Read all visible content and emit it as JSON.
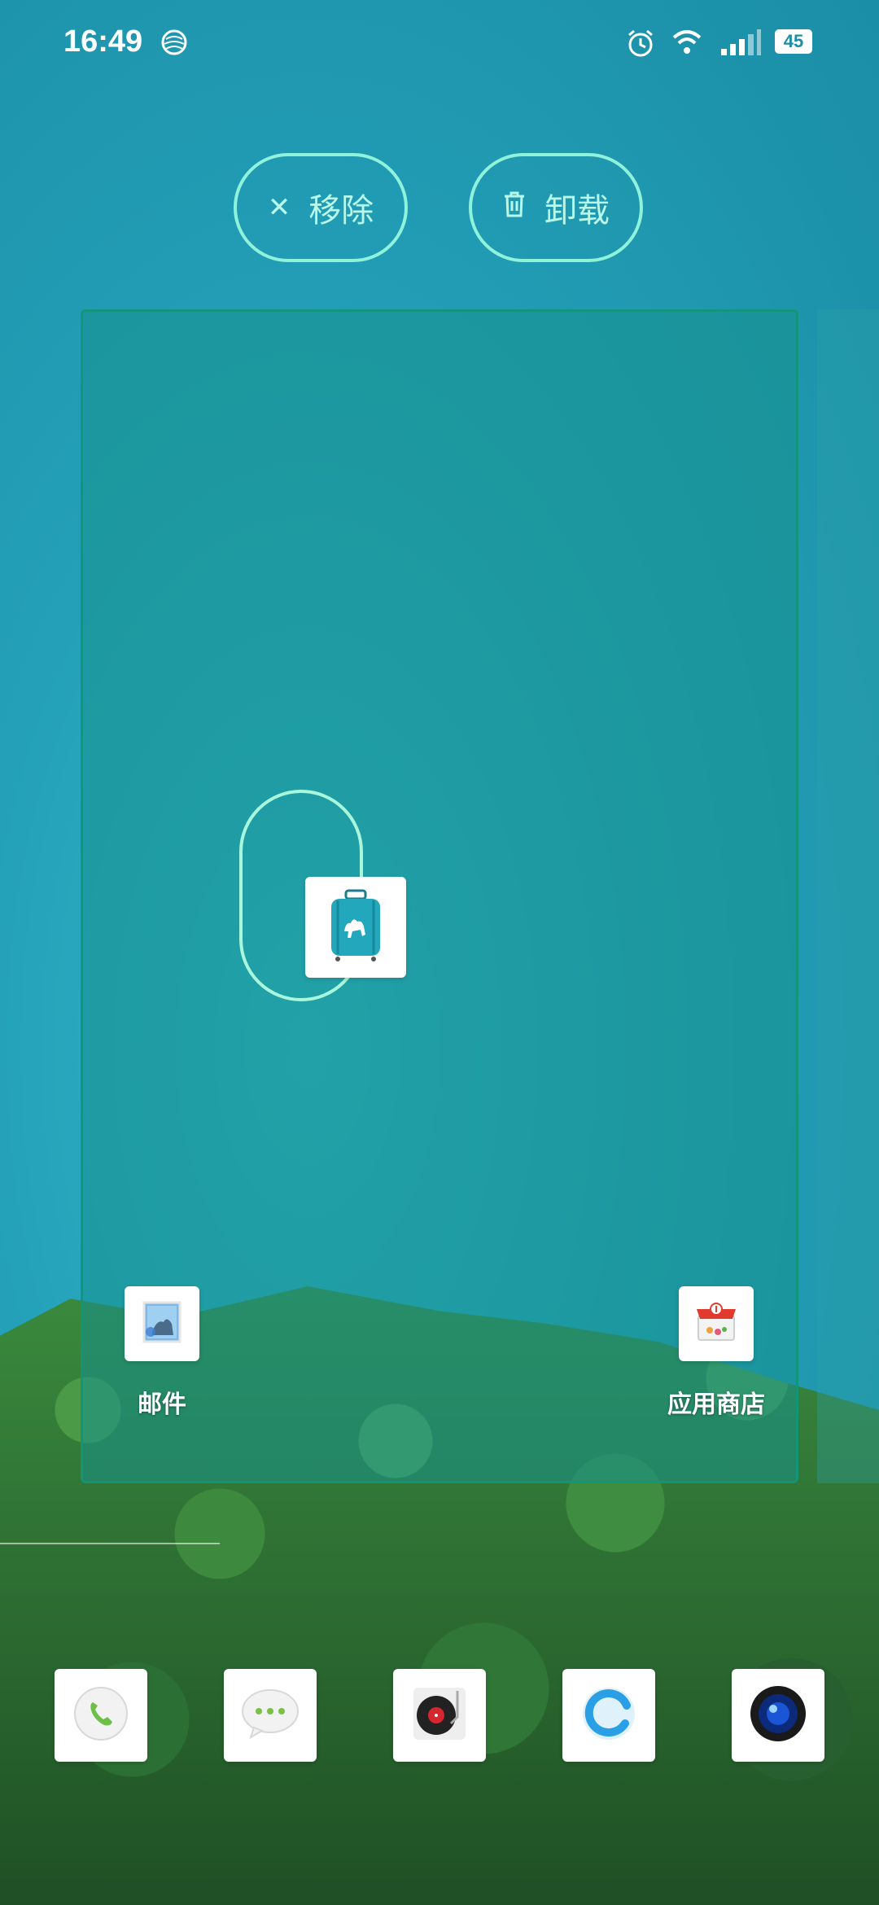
{
  "status_bar": {
    "time": "16:49",
    "battery": "45",
    "icons": [
      "carrier-icon",
      "alarm-icon",
      "wifi-icon",
      "signal-icon",
      "battery-icon"
    ]
  },
  "actions": {
    "remove_label": "移除",
    "uninstall_label": "卸载",
    "remove_icon": "close-icon",
    "uninstall_icon": "trash-icon"
  },
  "page_apps": [
    {
      "name": "邮件",
      "icon": "mail-icon"
    },
    {
      "name": "应用商店",
      "icon": "app-store-icon"
    }
  ],
  "dragging_app": {
    "icon": "travel-suitcase-icon"
  },
  "dock": [
    {
      "icon": "phone-icon"
    },
    {
      "icon": "messages-icon"
    },
    {
      "icon": "music-icon"
    },
    {
      "icon": "browser-icon"
    },
    {
      "icon": "camera-icon"
    }
  ],
  "colors": {
    "accent_outline": "#8ff3dc",
    "page_overlay": "#18918c"
  }
}
